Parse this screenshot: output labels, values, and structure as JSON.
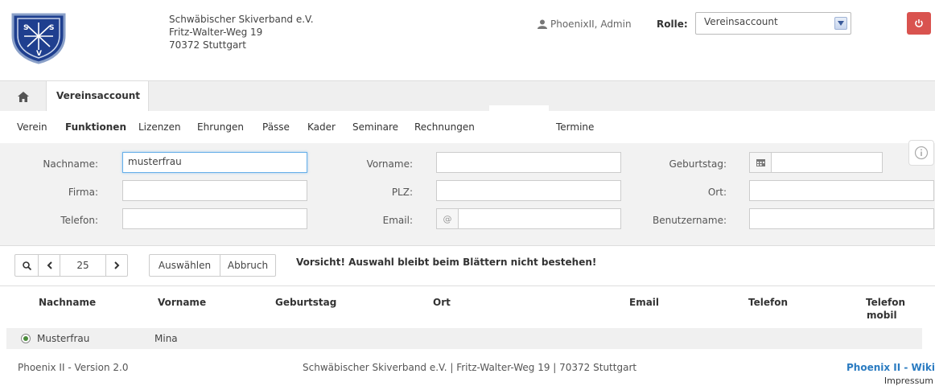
{
  "header": {
    "address_line1": "Schwäbischer Skiverband e.V.",
    "address_line2": "Fritz-Walter-Weg 19",
    "address_line3": "70372 Stuttgart",
    "user_name": "PhoenixII, Admin",
    "rolle_label": "Rolle:",
    "rolle_value": "Vereinsaccount",
    "logo_letters": "SSV"
  },
  "tabs": {
    "active_label": "Vereinsaccount"
  },
  "menu": {
    "items": [
      "Verein",
      "Funktionen",
      "Lizenzen",
      "Ehrungen",
      "Pässe",
      "Kader",
      "Seminare",
      "Rechnungen",
      "Termine"
    ],
    "active": "Funktionen"
  },
  "filter": {
    "nachname_label": "Nachname:",
    "nachname_value": "musterfrau",
    "vorname_label": "Vorname:",
    "geburtstag_label": "Geburtstag:",
    "firma_label": "Firma:",
    "plz_label": "PLZ:",
    "ort_label": "Ort:",
    "telefon_label": "Telefon:",
    "email_label": "Email:",
    "email_addon": "@",
    "benutzername_label": "Benutzername:"
  },
  "toolbar": {
    "page_size": "25",
    "auswaehlen_label": "Auswählen",
    "abbruch_label": "Abbruch",
    "warning": "Vorsicht! Auswahl bleibt beim Blättern nicht bestehen!"
  },
  "table": {
    "columns": {
      "nachname": "Nachname",
      "vorname": "Vorname",
      "geburtstag": "Geburtstag",
      "ort": "Ort",
      "email": "Email",
      "telefon": "Telefon",
      "telefon_mobil_1": "Telefon",
      "telefon_mobil_2": "mobil"
    },
    "rows": [
      {
        "nachname": "Musterfrau",
        "vorname": "Mina"
      }
    ]
  },
  "footer": {
    "version": "Phoenix II - Version 2.0",
    "center": "Schwäbischer Skiverband e.V. | Fritz-Walter-Weg 19 | 70372 Stuttgart",
    "wiki": "Phoenix II - Wiki",
    "impressum": "Impressum"
  },
  "colors": {
    "power_button": "#d9534f",
    "link": "#2a7bc1",
    "logo_blue": "#1f3f8f"
  }
}
